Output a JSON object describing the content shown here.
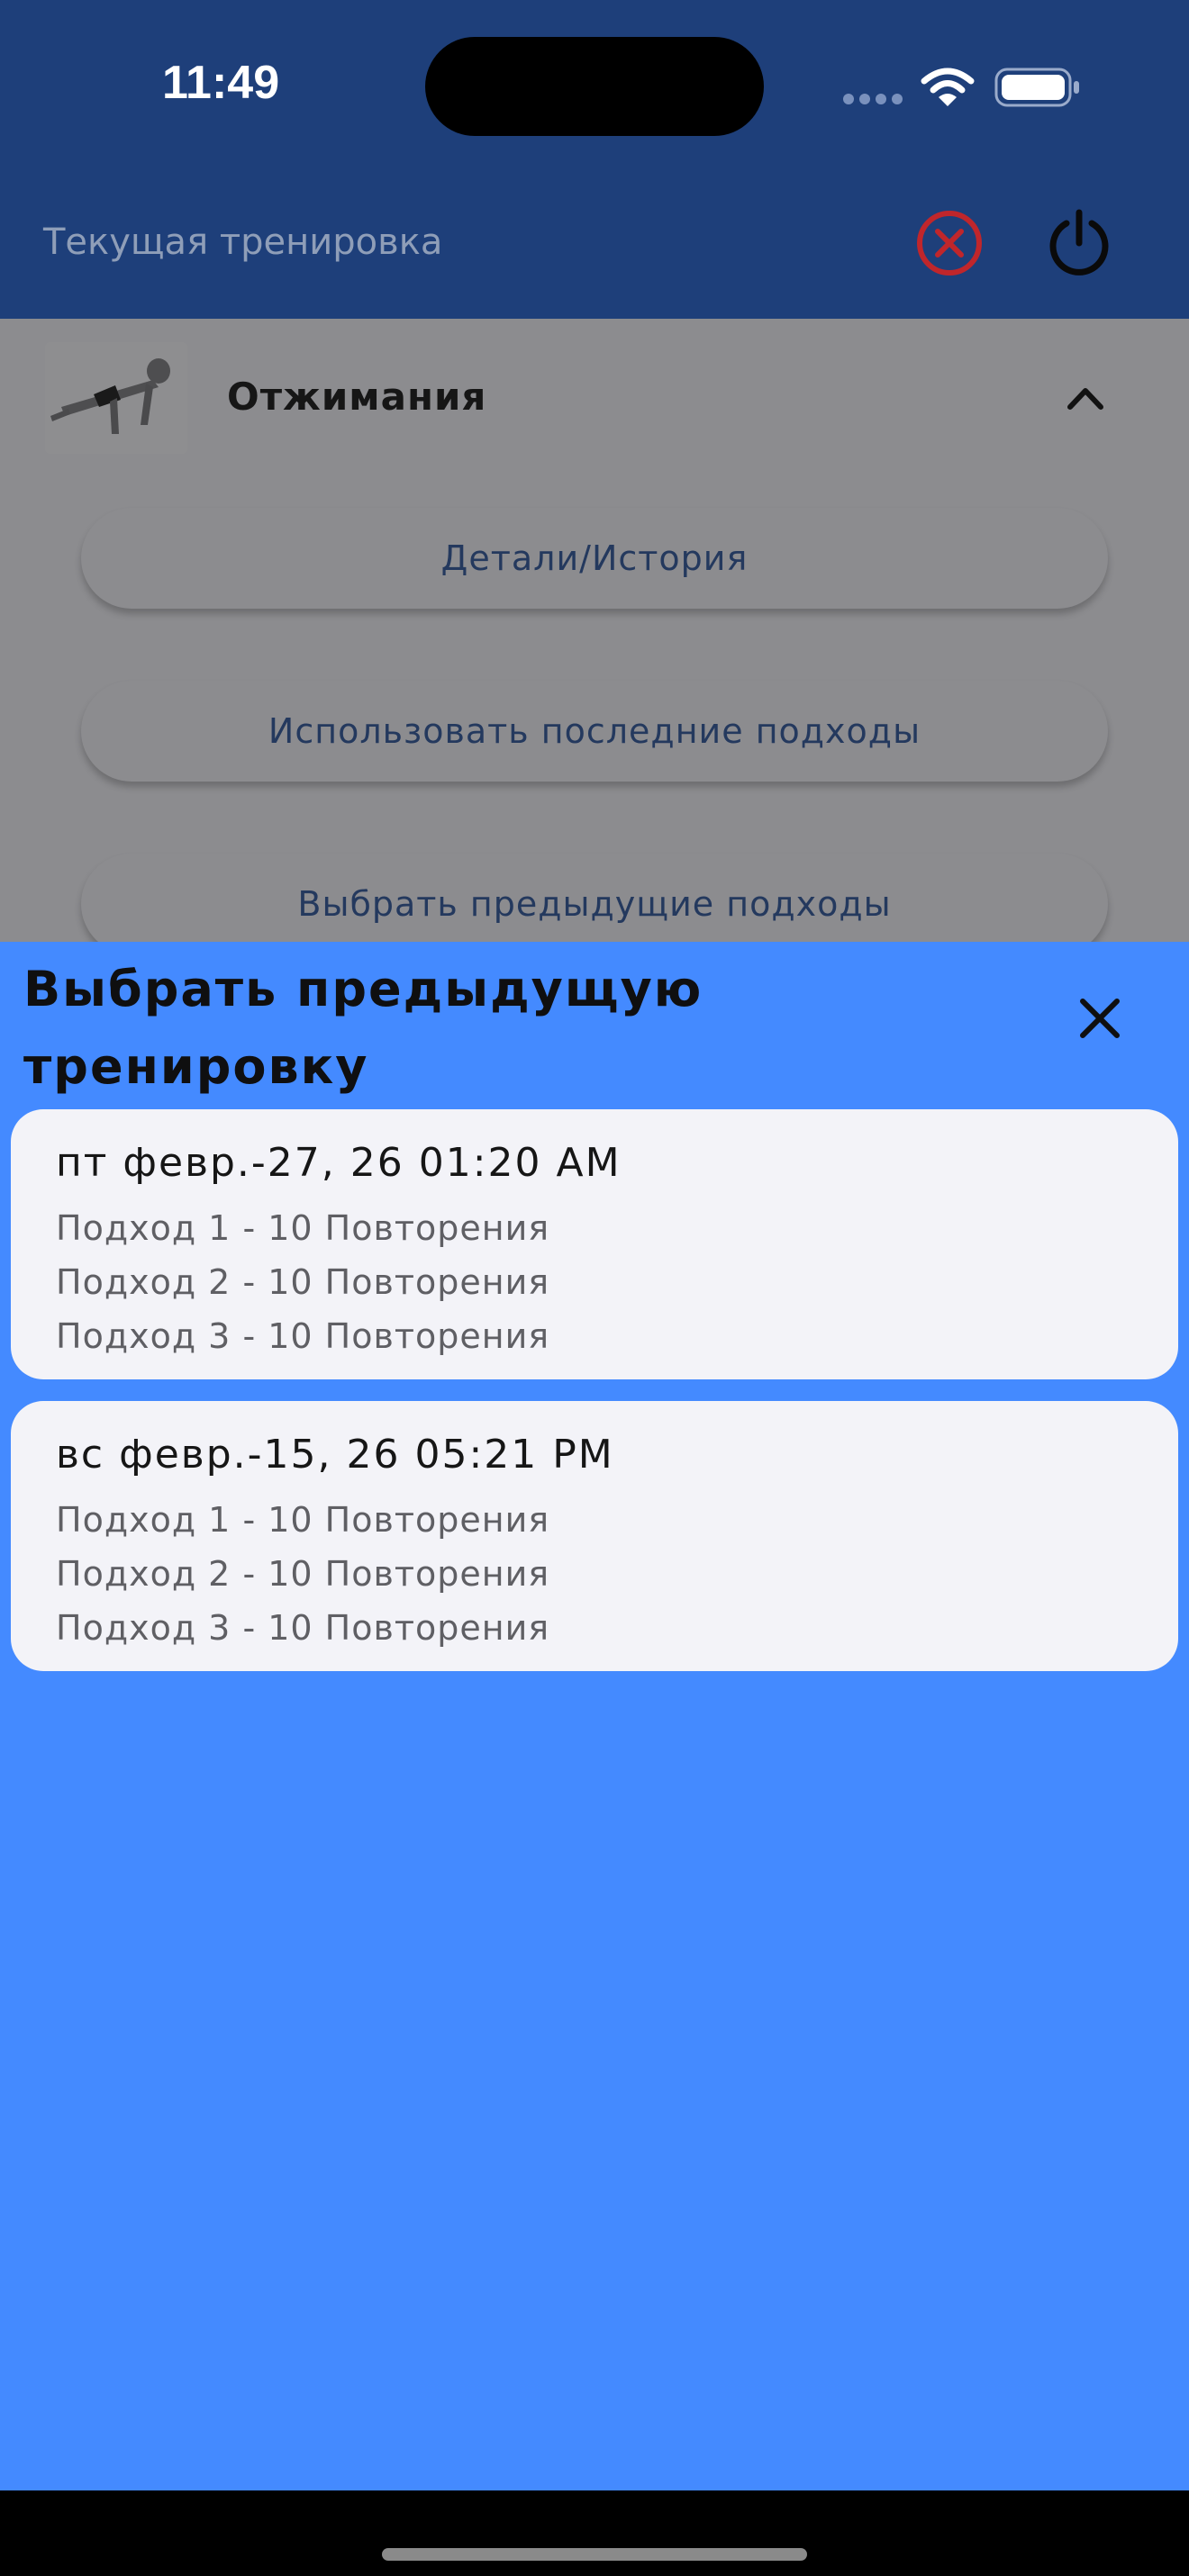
{
  "status_bar": {
    "time": "11:49"
  },
  "app_bar": {
    "title": "Текущая тренировка",
    "cancel_icon": "cancel-circle-icon",
    "power_icon": "power-icon"
  },
  "exercise": {
    "name": "Отжимания",
    "buttons": {
      "details": "Детали/История",
      "use_last": "Использовать последние подходы",
      "choose_previous": "Выбрать предыдущие подходы"
    }
  },
  "sheet": {
    "title": "Выбрать предыдущую тренировку",
    "workouts": [
      {
        "date": "пт февр.-27, 26 01:20 AM",
        "sets": [
          "Подход 1 - 10 Повторения",
          "Подход 2 - 10 Повторения",
          "Подход 3 - 10 Повторения"
        ]
      },
      {
        "date": "вс февр.-15, 26 05:21 PM",
        "sets": [
          "Подход 1 - 10 Повторения",
          "Подход 2 - 10 Повторения",
          "Подход 3 - 10 Повторения"
        ]
      }
    ]
  },
  "colors": {
    "app_bar": "#1E3F7A",
    "sheet": "#448AFF",
    "card": "#F3F3F8",
    "cancel": "#C0262B"
  }
}
